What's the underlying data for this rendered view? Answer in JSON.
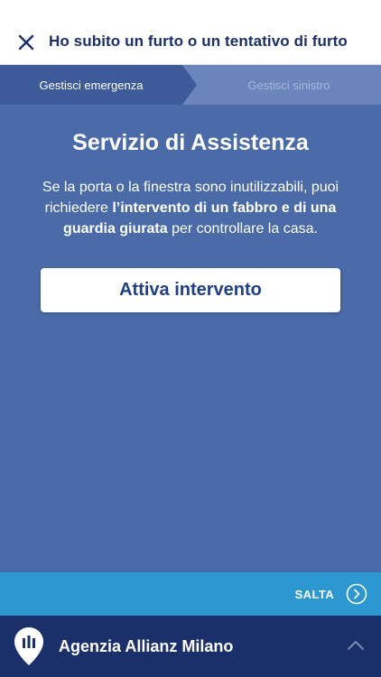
{
  "header": {
    "title": "Ho subito un furto o un tentativo di furto",
    "close_icon": "close-icon"
  },
  "steps": {
    "active_label": "Gestisci emergenza",
    "inactive_label": "Gestisci sinistro"
  },
  "main": {
    "title": "Servizio di Assistenza",
    "description_prefix": "Se la porta o la finestra sono inutilizzabili, puoi richiedere ",
    "description_bold": "l’intervento di un fabbro e di una guardia giurata",
    "description_suffix": " per controllare la casa.",
    "action_label": "Attiva intervento"
  },
  "skip": {
    "label": "SALTA",
    "icon": "chevron-right-circle-icon"
  },
  "footer": {
    "agency_name": "Agenzia Allianz Milano",
    "pin_icon": "location-pin-icon",
    "expand_icon": "chevron-up-icon"
  },
  "colors": {
    "brand_dark": "#1b2f6b",
    "content_bg": "#4a6aa8",
    "step_active": "#3d5b98",
    "step_inactive": "#6b86bd",
    "skip_bar": "#2c97d0"
  }
}
